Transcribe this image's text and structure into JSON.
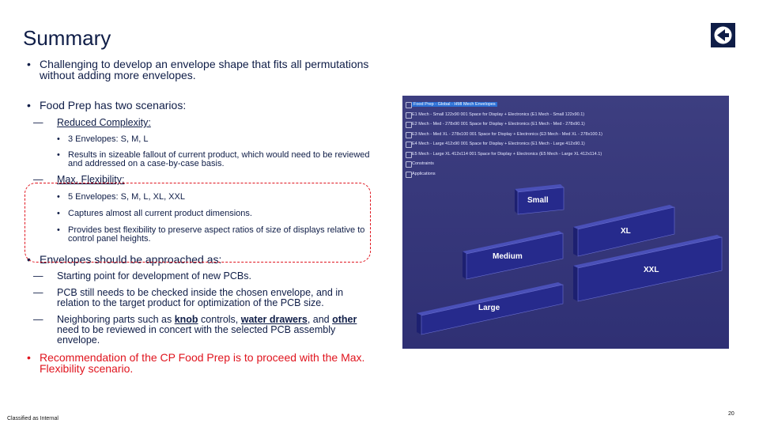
{
  "slide": {
    "title": "Summary",
    "footer": "Classified as Internal",
    "page_number": "20"
  },
  "bullets": {
    "b1": "Challenging to develop an envelope shape that fits all permutations without adding more envelopes.",
    "b2": "Food Prep has two scenarios:",
    "reduced": {
      "label": "Reduced Complexity:",
      "items": [
        "3 Envelopes:  S, M, L",
        "Results in sizeable fallout of current product, which would need to be reviewed and addressed on a case-by-case basis."
      ]
    },
    "maxflex": {
      "label": "Max. Flexibility:",
      "items": [
        "5 Envelopes: S, M, L, XL, XXL",
        "Captures almost all current product dimensions.",
        "Provides best flexibility to preserve aspect ratios of size of displays relative to control panel heights."
      ]
    },
    "b3": "Envelopes should be approached as:",
    "approach": [
      "Starting point for development of new PCBs.",
      "PCB still needs to be checked inside the chosen envelope, and in relation to the target product for optimization of the PCB size."
    ],
    "neighbor": {
      "pre": "Neighboring parts such as ",
      "knob": "knob",
      "mid1": " controls, ",
      "water": "water drawers",
      "mid2": ", and ",
      "other": "other",
      "post": " need to be reviewed in concert with the selected PCB assembly envelope."
    },
    "recommendation": "Recommendation of the CP Food Prep is to proceed with the Max. Flexibility scenario."
  },
  "cad": {
    "tree": {
      "root": "Food Prep - Global - HMI Mech Envelopes",
      "rows": [
        "E1 Mech - Small 122x90 001 Space for Display + Electronics (E1 Mech - Small 122x90.1)",
        "E2 Mech - Med - 278x90 001 Space for Display + Electronics (E1 Mech - Med - 278x90.1)",
        "E3 Mech - Med XL - 278x100 001 Space for Display + Electronics (E3 Mech - Med XL - 278x100.1)",
        "E4 Mech - Large 412x90 001 Space for Display + Electronics (E1 Mech - Large 412x90.1)",
        "E5 Mech - Large XL 412x114 001 Space for Display + Electronics (E5 Mech - Large XL 412x114.1)",
        "Constraints",
        "Applications"
      ]
    },
    "labels": {
      "small": "Small",
      "medium": "Medium",
      "xl": "XL",
      "xxl": "XXL",
      "large": "Large"
    },
    "colors": {
      "background": "#34357a",
      "box_front": "#262a8c",
      "box_top": "#3a3fa8",
      "highlight": "#2b6fd6"
    }
  },
  "colors": {
    "title": "#0f1d47",
    "recommendation": "#e0141e",
    "dashed_box": "#e0141e"
  },
  "logo": {
    "icon": "electrolux-logo-icon"
  }
}
